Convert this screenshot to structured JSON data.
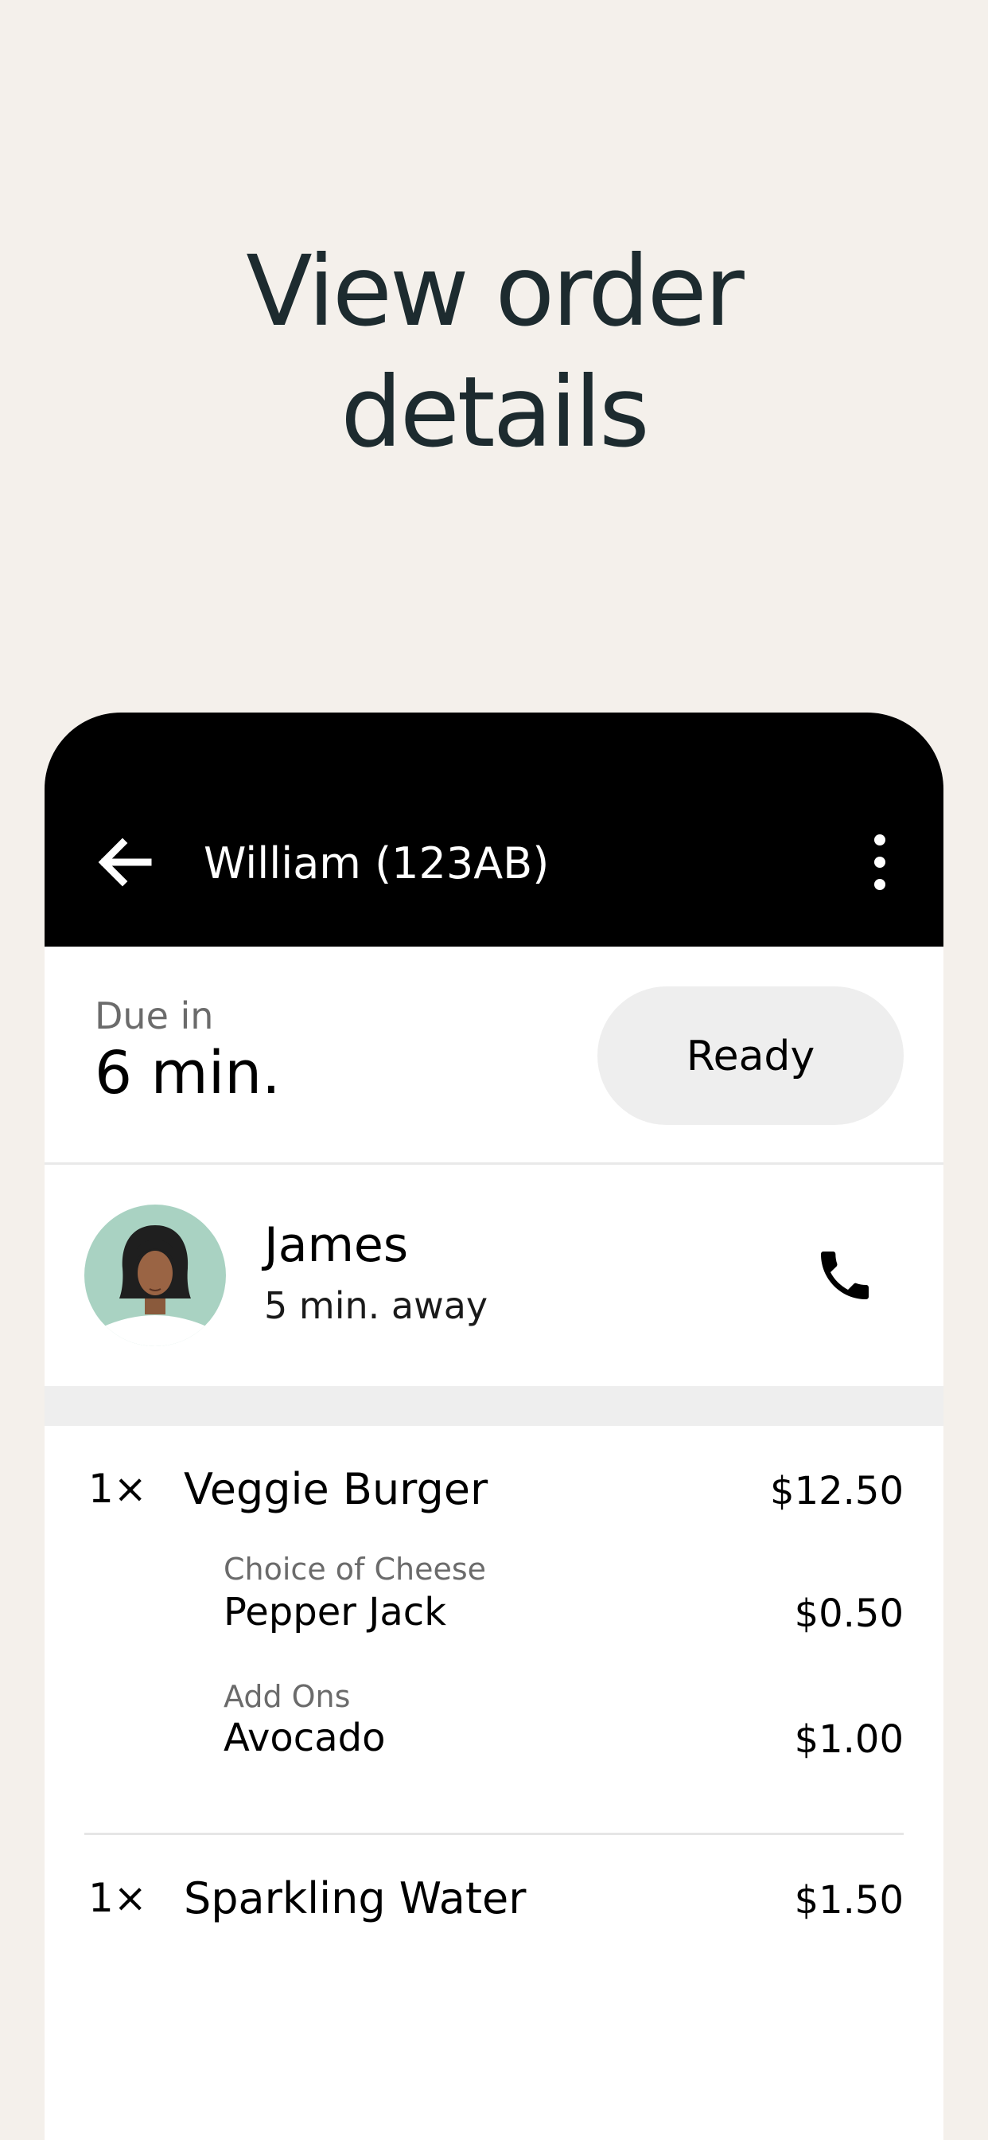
{
  "headline": {
    "line1": "View order",
    "line2": "details"
  },
  "topbar": {
    "title": "William (123AB)",
    "back_icon": "arrow-left-icon",
    "more_icon": "more-vertical-icon"
  },
  "due": {
    "label": "Due in",
    "value": "6 min.",
    "ready_button": "Ready"
  },
  "courier": {
    "name": "James",
    "eta": "5 min. away",
    "avatar_icon": "courier-avatar",
    "phone_icon": "phone-icon"
  },
  "order_items": [
    {
      "qty": "1×",
      "name": "Veggie Burger",
      "price": "$12.50",
      "modifiers": [
        {
          "group": "Choice of Cheese",
          "value": "Pepper Jack",
          "price": "$0.50"
        },
        {
          "group": "Add Ons",
          "value": "Avocado",
          "price": "$1.00"
        }
      ]
    },
    {
      "qty": "1×",
      "name": "Sparkling Water",
      "price": "$1.50",
      "modifiers": []
    }
  ],
  "colors": {
    "page_background": "#f4f0eb",
    "headline_text": "#1d2b2f",
    "topbar_background": "#000000",
    "ready_button_background": "#eeeeee",
    "avatar_background": "#a9d2c2"
  }
}
